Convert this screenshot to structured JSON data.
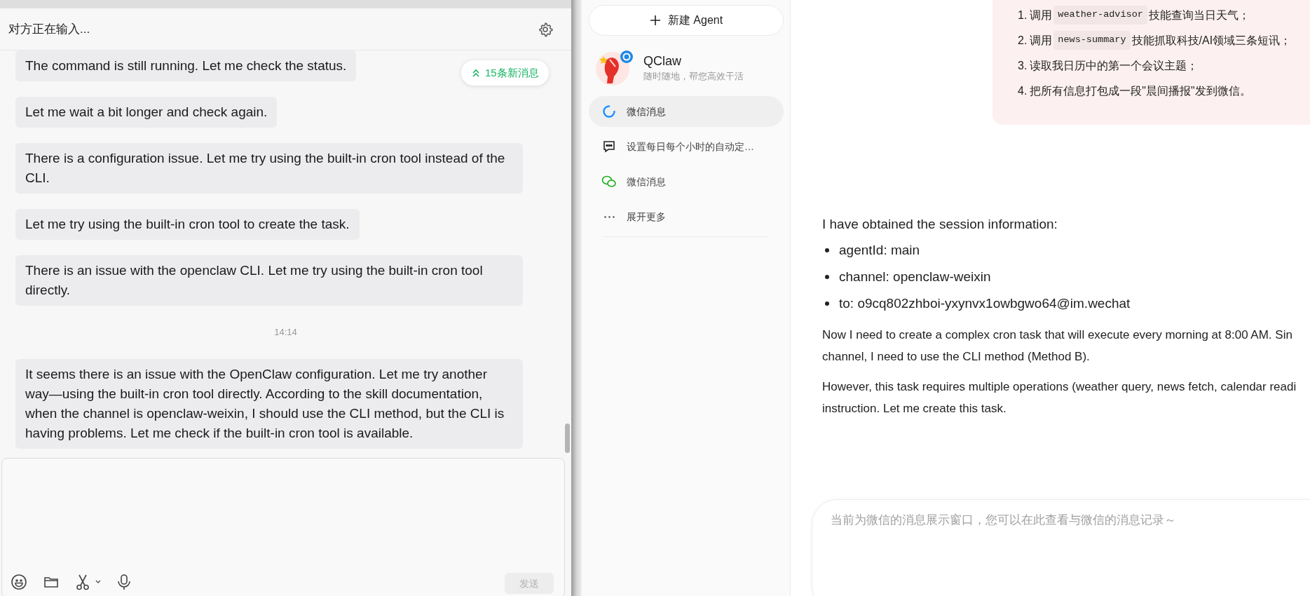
{
  "chat_panel": {
    "title": "对方正在输入...",
    "new_messages_badge": "15条新消息",
    "messages": [
      {
        "kind": "bubble",
        "text": "The command is still running. Let me check the status."
      },
      {
        "kind": "bubble",
        "text": "Let me wait a bit longer and check again."
      },
      {
        "kind": "bubble",
        "text": "There is a configuration issue. Let me try using the built-in cron tool instead of the CLI."
      },
      {
        "kind": "bubble",
        "text": "Let me try using the built-in cron tool to create the task."
      },
      {
        "kind": "bubble",
        "text": "There is an issue with the openclaw CLI. Let me try using the built-in cron tool directly."
      },
      {
        "kind": "timestamp",
        "text": "14:14"
      },
      {
        "kind": "bubble",
        "text": "It seems there is an issue with the OpenClaw configuration. Let me try another way—using the built-in cron tool directly. According to the skill documentation, when the channel is openclaw-weixin, I should use the CLI method, but the CLI is having problems. Let me check if the built-in cron tool is available."
      }
    ],
    "send_button": {
      "label": "发送",
      "disabled": true
    }
  },
  "sidebar": {
    "new_agent_button": "新建 Agent",
    "agent": {
      "name": "QClaw",
      "tagline": "随时随地，帮您高效干活"
    },
    "items": [
      {
        "kind": "loading",
        "label": "微信消息",
        "selected": true
      },
      {
        "kind": "chat",
        "label": "设置每日每个小时的自动定…",
        "selected": false
      },
      {
        "kind": "wechat",
        "label": "微信消息",
        "selected": false
      },
      {
        "kind": "more",
        "label": "展开更多",
        "selected": false
      }
    ]
  },
  "conversation": {
    "request_steps": [
      {
        "number": "1.",
        "parts": [
          {
            "kind": "text",
            "text": "调用"
          },
          {
            "kind": "code",
            "text": "weather-advisor"
          },
          {
            "kind": "text",
            "text": "技能查询当日天气；"
          }
        ]
      },
      {
        "number": "2.",
        "parts": [
          {
            "kind": "text",
            "text": "调用"
          },
          {
            "kind": "code",
            "text": "news-summary"
          },
          {
            "kind": "text",
            "text": "技能抓取科技/AI领域三条短讯；"
          }
        ]
      },
      {
        "number": "3.",
        "parts": [
          {
            "kind": "text",
            "text": "读取我日历中的第一个会议主题；"
          }
        ]
      },
      {
        "number": "4.",
        "parts": [
          {
            "kind": "text",
            "text": "把所有信息打包成一段\"晨间播报\"发到微信。"
          }
        ]
      }
    ],
    "reply": {
      "intro": "I have obtained the session information:",
      "bullets": [
        "agentId: main",
        "channel: openclaw-weixin",
        "to: o9cq802zhboi-yxynvx1owbgwo64@im.wechat"
      ],
      "paragraphs": [
        [
          "Now I need to create a complex cron task that will execute every morning at 8:00 AM. Sin",
          "channel, I need to use the CLI method (Method B)."
        ],
        [
          "However, this task requires multiple operations (weather query, news fetch, calendar readi",
          "instruction. Let me create this task."
        ]
      ]
    },
    "input": {
      "placeholder": "当前为微信的消息展示窗口，您可以在此查看与微信的消息记录～"
    }
  }
}
